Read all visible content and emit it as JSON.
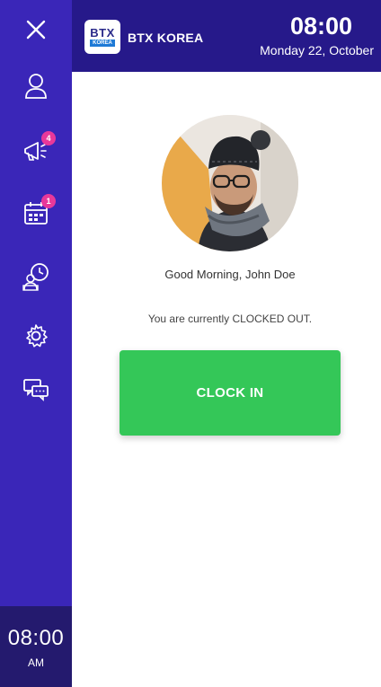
{
  "sidebar": {
    "items": [
      {
        "icon": "user-icon",
        "badge": ""
      },
      {
        "icon": "megaphone-icon",
        "badge": "4"
      },
      {
        "icon": "calendar-icon",
        "badge": "1"
      },
      {
        "icon": "timesheet-icon",
        "badge": ""
      },
      {
        "icon": "gear-icon",
        "badge": ""
      },
      {
        "icon": "chat-icon",
        "badge": ""
      }
    ],
    "clock": {
      "time": "08:00",
      "ampm": "AM"
    }
  },
  "header": {
    "logo_text": "BTX",
    "logo_sub": "KOREA",
    "brand": "BTX KOREA",
    "time": "08:00",
    "date": "Monday 22, October"
  },
  "main": {
    "greeting": "Good Morning, John Doe",
    "status": "You are currently CLOCKED OUT.",
    "clock_in_label": "CLOCK IN"
  },
  "colors": {
    "sidebar": "#3a26b8",
    "topbar": "#26198a",
    "badge": "#e8389a",
    "button": "#34c758"
  }
}
